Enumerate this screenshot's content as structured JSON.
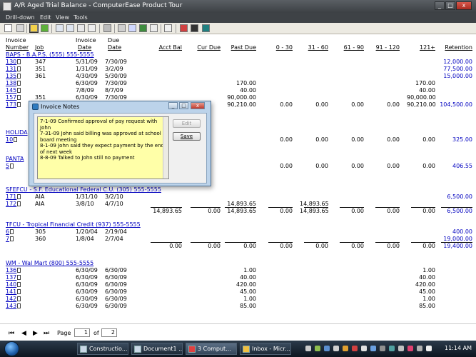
{
  "window": {
    "title": "A/R Aged Trial Balance - ComputerEase Product Tour",
    "min": "_",
    "max": "□",
    "close": "x"
  },
  "menu": [
    "Drill-down",
    "Edit",
    "View",
    "Tools"
  ],
  "columns": {
    "invoice_number": [
      "Invoice",
      "Number"
    ],
    "job": "Job",
    "invoice_date": [
      "Invoice",
      "Date"
    ],
    "due_date": [
      "Due",
      "Date"
    ],
    "acct_bal": "Acct Bal",
    "cur_due": "Cur Due",
    "past_due": "Past Due",
    "b0_30": "0 - 30",
    "b31_60": "31 - 60",
    "b61_90": "61 - 90",
    "b91_120": "91 - 120",
    "b121": "121+",
    "retention": "Retention"
  },
  "sections": [
    {
      "customer": "BAPS - B.A.P.S. (555) 555-5555",
      "rows": [
        [
          "130",
          "347",
          "5/31/09",
          "7/30/09",
          "",
          "",
          "",
          "",
          "",
          "",
          "",
          "",
          "12,000.00"
        ],
        [
          "131",
          "351",
          "1/31/09",
          "3/2/09",
          "",
          "",
          "",
          "",
          "",
          "",
          "",
          "",
          "77,500.00"
        ],
        [
          "135",
          "361",
          "4/30/09",
          "5/30/09",
          "",
          "",
          "",
          "",
          "",
          "",
          "",
          "",
          "15,000.00"
        ],
        [
          "138",
          "",
          "6/30/09",
          "7/30/09",
          "",
          "",
          "170.00",
          "",
          "",
          "",
          "",
          "170.00",
          ""
        ],
        [
          "145",
          "",
          "7/8/09",
          "8/7/09",
          "",
          "",
          "40.00",
          "",
          "",
          "",
          "",
          "40.00",
          ""
        ],
        [
          "157",
          "351",
          "6/30/09",
          "7/30/09",
          "",
          "",
          "90,000.00",
          "",
          "",
          "",
          "",
          "90,000.00",
          ""
        ],
        [
          "173",
          "",
          "",
          "",
          "",
          "",
          "90,210.00",
          "0.00",
          "0.00",
          "0.00",
          "0.00",
          "90,210.00",
          "104,500.00"
        ]
      ]
    },
    {
      "customer": "HOLIDA",
      "rows": [
        [
          "10",
          "",
          "",
          "",
          "",
          "",
          "",
          "0.00",
          "0.00",
          "0.00",
          "0.00",
          "0.00",
          "325.00"
        ]
      ],
      "retention_top": "325.00"
    },
    {
      "customer": "PANTA",
      "rows": [
        [
          "5",
          "",
          "",
          "",
          "",
          "",
          "",
          "0.00",
          "0.00",
          "0.00",
          "0.00",
          "0.00",
          "406.55"
        ]
      ],
      "retention_top": "406.55"
    },
    {
      "customer": "SFEFCU - S.F. Educational Federal C.U. (305) 555-5555",
      "rows": [
        [
          "171",
          "AIA",
          "1/31/10",
          "3/2/10",
          "",
          "",
          "",
          "",
          "",
          "",
          "",
          "",
          "6,500.00"
        ],
        [
          "172",
          "AIA",
          "3/8/10",
          "4/7/10",
          "",
          "",
          "14,893.65",
          "",
          "14,893.65",
          "",
          "",
          "",
          ""
        ]
      ],
      "totals": [
        "14,893.65",
        "0.00",
        "14,893.65",
        "0.00",
        "14,893.65",
        "0.00",
        "0.00",
        "0.00",
        "6,500.00"
      ]
    },
    {
      "customer": "TFCU - Tropical Financial Credit (937) 555-5555",
      "rows": [
        [
          "6",
          "305",
          "1/20/04",
          "2/19/04",
          "",
          "",
          "",
          "",
          "",
          "",
          "",
          "",
          "400.00"
        ],
        [
          "7",
          "360",
          "1/8/04",
          "2/7/04",
          "",
          "",
          "",
          "",
          "",
          "",
          "",
          "",
          "19,000.00"
        ]
      ],
      "totals": [
        "0.00",
        "0.00",
        "0.00",
        "0.00",
        "0.00",
        "0.00",
        "0.00",
        "0.00",
        "19,400.00"
      ]
    },
    {
      "customer": "WM - Wal Mart (800) 555-5555",
      "rows": [
        [
          "136",
          "",
          "6/30/09",
          "6/30/09",
          "",
          "",
          "1.00",
          "",
          "",
          "",
          "",
          "1.00",
          ""
        ],
        [
          "137",
          "",
          "6/30/09",
          "6/30/09",
          "",
          "",
          "40.00",
          "",
          "",
          "",
          "",
          "40.00",
          ""
        ],
        [
          "140",
          "",
          "6/30/09",
          "6/30/09",
          "",
          "",
          "420.00",
          "",
          "",
          "",
          "",
          "420.00",
          ""
        ],
        [
          "141",
          "",
          "6/30/09",
          "6/30/09",
          "",
          "",
          "45.00",
          "",
          "",
          "",
          "",
          "45.00",
          ""
        ],
        [
          "142",
          "",
          "6/30/09",
          "6/30/09",
          "",
          "",
          "1.00",
          "",
          "",
          "",
          "",
          "1.00",
          ""
        ],
        [
          "143",
          "",
          "6/30/09",
          "6/30/09",
          "",
          "",
          "85.00",
          "",
          "",
          "",
          "",
          "85.00",
          ""
        ]
      ]
    }
  ],
  "dialog": {
    "title": "Invoice Notes",
    "notes": [
      "7-1-09 Confirmed approval of pay request with John",
      "7-31-09 John said billing was approved at school board meeting",
      "8-1-09 John said they expect payment by the end of next week",
      "8-8-09 Talked to John still no payment"
    ],
    "edit_label": "Edit",
    "save_label": "Save"
  },
  "pager": {
    "label": "Page",
    "current": "1",
    "of": "of",
    "total": "2"
  },
  "taskbar": {
    "tasks": [
      "Constructio...",
      "Document1 ...",
      "3 Comput...",
      "Inbox - Micr..."
    ],
    "clock": "11:14 AM"
  }
}
